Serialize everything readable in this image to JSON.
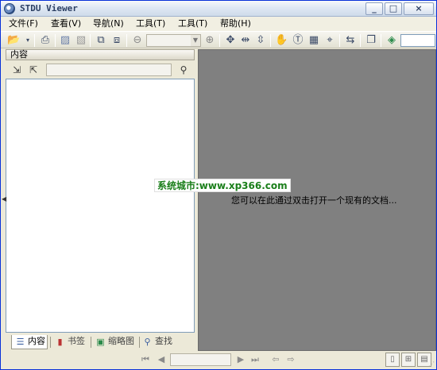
{
  "window": {
    "title": "STDU Viewer"
  },
  "titlebar_buttons": {
    "minimize": "_",
    "maximize": "□",
    "close": "×"
  },
  "menu": [
    {
      "label": "文件(F)"
    },
    {
      "label": "查看(V)"
    },
    {
      "label": "导航(N)"
    },
    {
      "label": "工具(T)"
    },
    {
      "label": "工具(T)"
    },
    {
      "label": "帮助(H)"
    }
  ],
  "toolbar": {
    "zoom_value": "",
    "goto_value": "",
    "icons": [
      "open-folder-icon",
      "print-icon",
      "edit-icon",
      "disabled-edit-icon",
      "page-copy-icon",
      "page-export-icon",
      "zoom-out-icon",
      "zoom-in-icon",
      "fit-page-icon",
      "fit-width-icon",
      "fit-height-icon",
      "hand-tool-icon",
      "select-text-icon",
      "select-image-icon",
      "snapshot-icon",
      "rotate-icon",
      "two-pages-icon",
      "go-icon"
    ]
  },
  "left_panel": {
    "header": "内容",
    "search_value": "",
    "tabs": [
      {
        "label": "内容",
        "active": true
      },
      {
        "label": "书签",
        "active": false
      },
      {
        "label": "缩略图",
        "active": false
      },
      {
        "label": "查找",
        "active": false
      }
    ]
  },
  "document": {
    "hint": "您可以在此通过双击打开一个现有的文档...",
    "watermark": "系统城市:www.xp366.com"
  },
  "navigation": {
    "page_value": ""
  },
  "colors": {
    "doc_background": "#808080",
    "watermark_text": "#1b7f1b",
    "title_border": "#0831d9"
  }
}
